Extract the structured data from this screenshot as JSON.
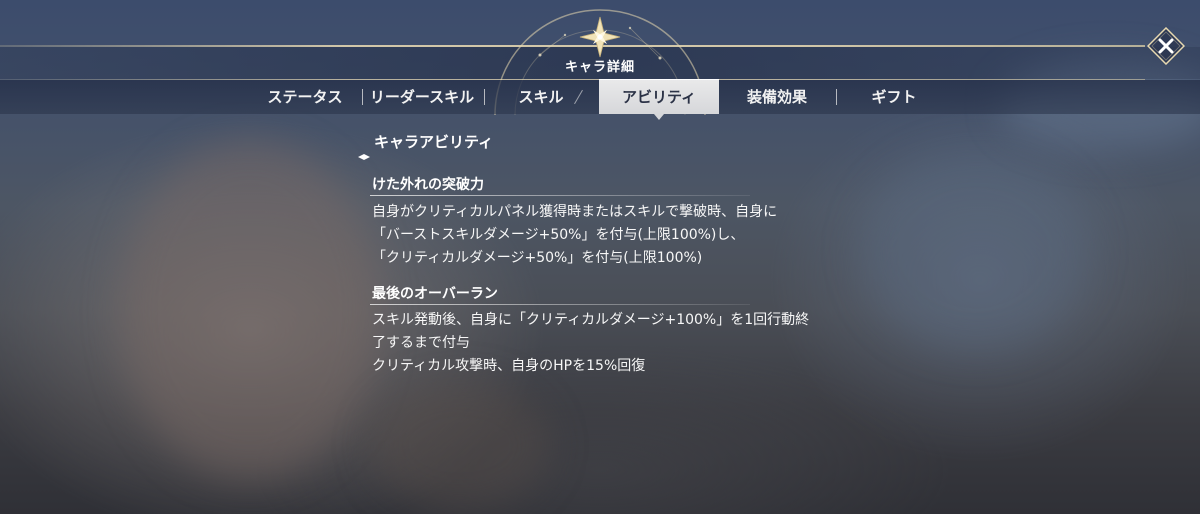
{
  "header": {
    "title": "キャラ詳細",
    "emblem_icon": "compass-star-icon",
    "close_icon": "close-icon"
  },
  "tabs": [
    {
      "label": "ステータス",
      "active": false
    },
    {
      "label": "リーダースキル",
      "active": false
    },
    {
      "label": "スキル",
      "active": false
    },
    {
      "label": "アビリティ",
      "active": true
    },
    {
      "label": "装備効果",
      "active": false
    },
    {
      "label": "ギフト",
      "active": false
    }
  ],
  "content": {
    "section_title": "キャラアビリティ",
    "abilities": [
      {
        "name": "けた外れの突破力",
        "lines": [
          "自身がクリティカルパネル獲得時またはスキルで撃破時、自身に",
          "「バーストスキルダメージ+50%」を付与(上限100%)し、",
          "「クリティカルダメージ+50%」を付与(上限100%)"
        ]
      },
      {
        "name": "最後のオーバーラン",
        "lines": [
          "スキル発動後、自身に「クリティカルダメージ+100%」を1回行動終",
          "了するまで付与",
          "クリティカル攻撃時、自身のHPを15%回復"
        ]
      }
    ]
  },
  "colors": {
    "accent_gold": "#e8d9b0",
    "active_tab_bg": "#e0e1e4",
    "active_tab_text": "#2b3246"
  }
}
